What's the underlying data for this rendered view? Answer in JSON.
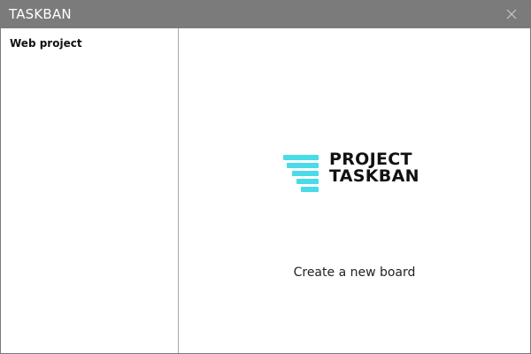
{
  "window": {
    "title": "TASKBAN",
    "close_icon": "close-icon"
  },
  "sidebar": {
    "items": [
      {
        "label": "Web project"
      }
    ]
  },
  "main": {
    "logo": {
      "line1": "PROJECT",
      "line2": "TASKBAN",
      "accent_color": "#49dbe7",
      "icon": "logo-bars-icon"
    },
    "create_label": "Create a new board"
  },
  "colors": {
    "titlebar": "#7b7b7b",
    "accent": "#49dbe7"
  }
}
